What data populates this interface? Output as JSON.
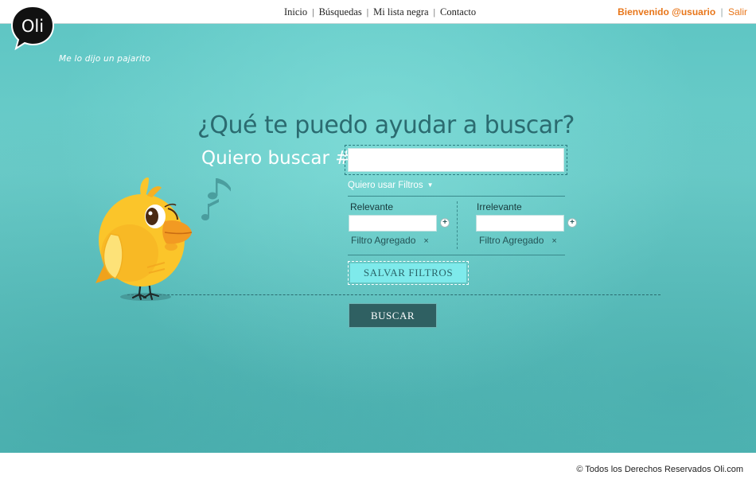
{
  "brand": {
    "logo_text": "Oli",
    "tagline": "Me lo dijo un pajarito"
  },
  "nav": {
    "items": [
      "Inicio",
      "Búsquedas",
      "Mi lista negra",
      "Contacto"
    ],
    "separator": "|"
  },
  "user": {
    "welcome": "Bienvenido @usuario",
    "separator": "|",
    "logout": "Salir"
  },
  "main": {
    "headline": "¿Qué te puedo ayudar a buscar?",
    "search_label": "Quiero buscar #",
    "search_value": "",
    "filters_toggle": "Quiero usar Filtros",
    "filters": {
      "relevant": {
        "label": "Relevante",
        "value": "",
        "chip": "Filtro Agregado",
        "chip_remove": "×"
      },
      "irrelevant": {
        "label": "Irrelevante",
        "value": "",
        "chip": "Filtro Agregado",
        "chip_remove": "×"
      },
      "add_symbol": "+"
    },
    "save_filters": "SALVAR FILTROS",
    "search_button": "BUSCAR"
  },
  "footer": {
    "copyright": "© Todos los Derechos Reservados Oli.com"
  },
  "colors": {
    "teal_background": "#62c8c6",
    "accent_orange": "#e8761a",
    "headline": "#2b6b70",
    "search_button": "#2f6062",
    "save_button": "#7eeaeb"
  },
  "icons": [
    "speech-bubble-logo-icon",
    "dropdown-caret-icon",
    "plus-circle-icon",
    "close-x-icon",
    "music-note-icon",
    "bird-illustration"
  ]
}
